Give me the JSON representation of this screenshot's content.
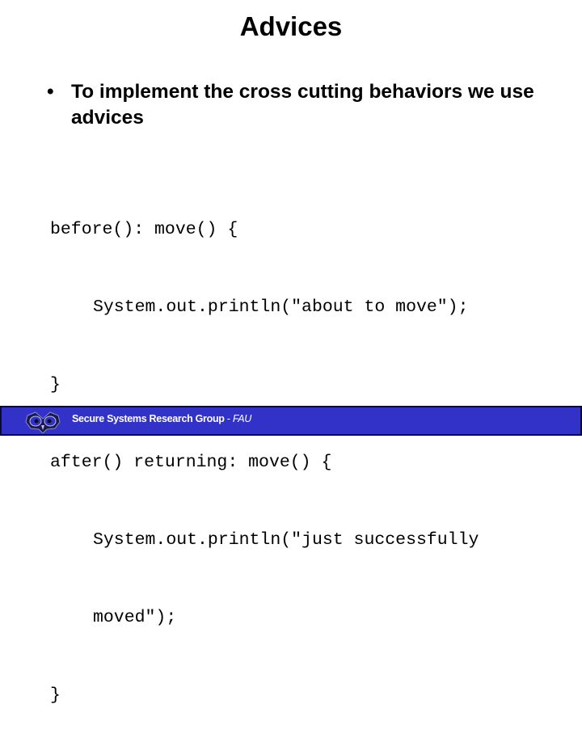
{
  "slide": {
    "title": "Advices",
    "bullets": [
      {
        "symbol": "•",
        "text": "To implement the cross cutting behaviors we use advices"
      }
    ],
    "code_lines": [
      {
        "text": "before(): move() {",
        "indent": false
      },
      {
        "text": "System.out.println(\"about to move\");",
        "indent": true
      },
      {
        "text": "}",
        "indent": false
      },
      {
        "text": "after() returning: move() {",
        "indent": false
      },
      {
        "text": "System.out.println(\"just successfully",
        "indent": true
      },
      {
        "text": "moved\");",
        "indent": true
      },
      {
        "text": "}",
        "indent": false
      }
    ]
  },
  "footer": {
    "logo_icon": "owl-icon",
    "group_name": "Secure Systems Research Group",
    "separator": " - ",
    "org": "FAU",
    "background_color": "#3232c8"
  }
}
